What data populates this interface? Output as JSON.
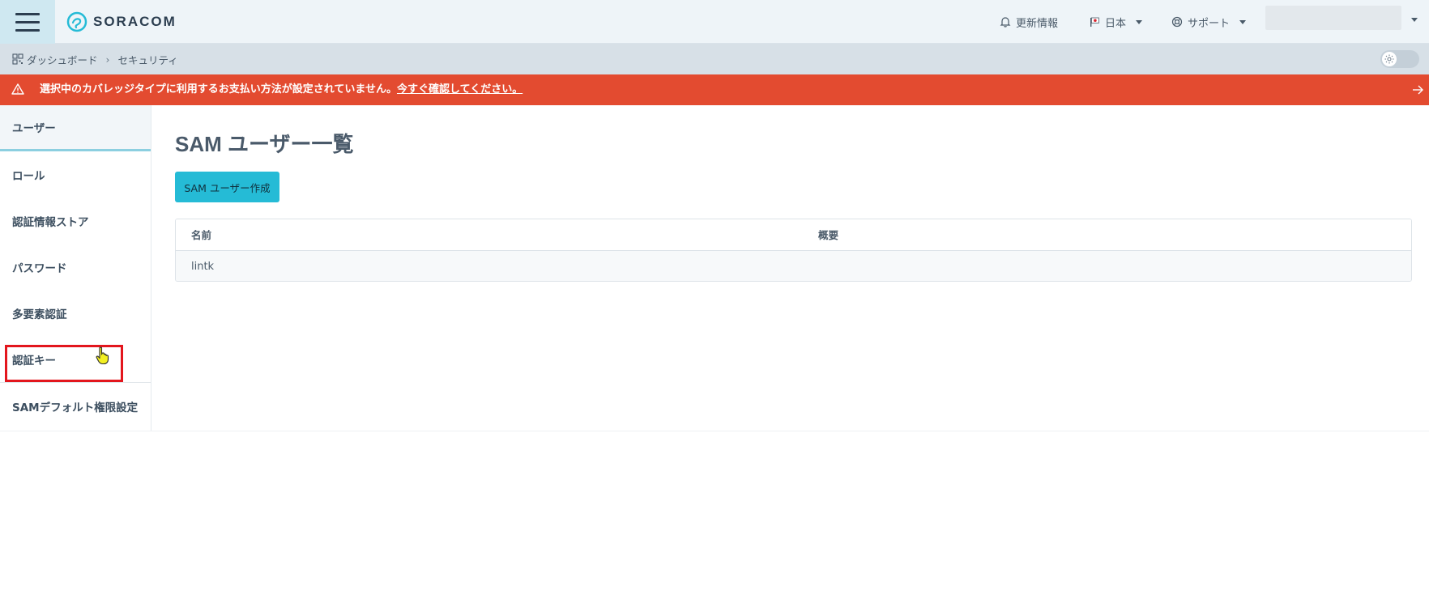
{
  "header": {
    "logo_text": "SORACOM",
    "updates_label": "更新情報",
    "language_label": "日本",
    "support_label": "サポート"
  },
  "breadcrumb": {
    "dashboard": "ダッシュボード",
    "current": "セキュリティ"
  },
  "alert": {
    "message": "選択中のカバレッジタイプに利用するお支払い方法が設定されていません。",
    "link": "今すぐ確認してください。"
  },
  "sidebar": {
    "items": [
      {
        "label": "ユーザー",
        "active": true
      },
      {
        "label": "ロール"
      },
      {
        "label": "認証情報ストア"
      },
      {
        "label": "パスワード"
      },
      {
        "label": "多要素認証"
      },
      {
        "label": "認証キー"
      },
      {
        "label": "SAMデフォルト権限設定"
      }
    ]
  },
  "main": {
    "title": "SAM ユーザー一覧",
    "create_button": "SAM ユーザー作成",
    "table": {
      "columns": [
        "名前",
        "概要"
      ],
      "rows": [
        [
          "lintk",
          ""
        ]
      ]
    }
  },
  "colors": {
    "accent": "#25bbd6",
    "alert": "#e34b30",
    "highlight": "#e3161d"
  }
}
